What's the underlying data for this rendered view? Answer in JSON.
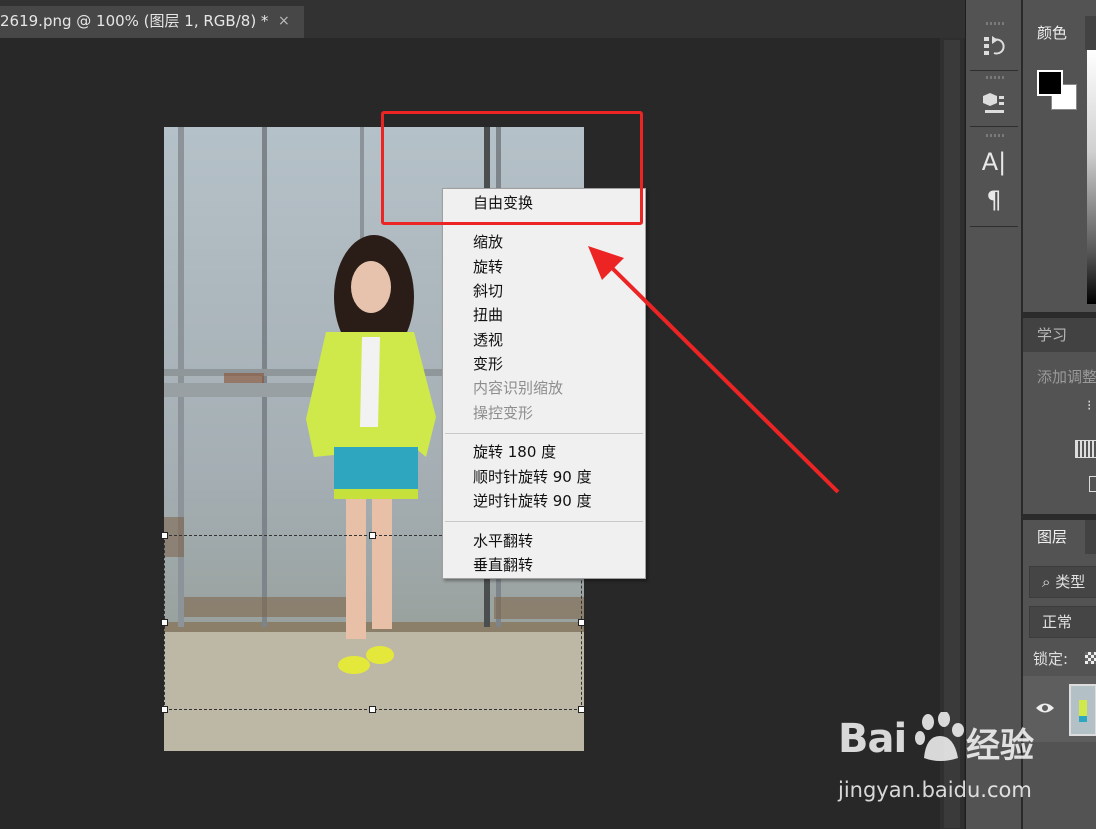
{
  "document_tab": {
    "title": "2619.png @ 100% (图层 1, RGB/8) *",
    "close_glyph": "×"
  },
  "context_menu": {
    "items": [
      {
        "label": "自由变换",
        "enabled": true
      },
      {
        "label": "缩放",
        "enabled": true
      },
      {
        "label": "旋转",
        "enabled": true
      },
      {
        "label": "斜切",
        "enabled": true
      },
      {
        "label": "扭曲",
        "enabled": true
      },
      {
        "label": "透视",
        "enabled": true
      },
      {
        "label": "变形",
        "enabled": true
      },
      {
        "label": "内容识别缩放",
        "enabled": false
      },
      {
        "label": "操控变形",
        "enabled": false
      },
      {
        "label": "旋转 180 度",
        "enabled": true
      },
      {
        "label": "顺时针旋转 90 度",
        "enabled": true
      },
      {
        "label": "逆时针旋转 90 度",
        "enabled": true
      },
      {
        "label": "水平翻转",
        "enabled": true
      },
      {
        "label": "垂直翻转",
        "enabled": true
      }
    ]
  },
  "tool_strip": {
    "icons": [
      "history-icon",
      "3d-object-icon",
      "character-icon",
      "paragraph-icon"
    ],
    "character_glyph": "A|",
    "paragraph_glyph": "¶"
  },
  "panels": {
    "color": {
      "tab_label": "颜色",
      "foreground": "#000000",
      "background": "#ffffff"
    },
    "learn": {
      "tab_label": "学习",
      "text": "添加调整"
    },
    "layers": {
      "tab_label": "图层",
      "filter_label": "类型",
      "blend_mode": "正常",
      "lock_label": "锁定:"
    }
  },
  "watermark": {
    "brand_left": "Bai",
    "brand_right": "经验",
    "url": "jingyan.baidu.com"
  },
  "colors": {
    "annotation_red": "#ec2424",
    "ps_panel": "#535353",
    "canvas_bg": "#282828"
  }
}
